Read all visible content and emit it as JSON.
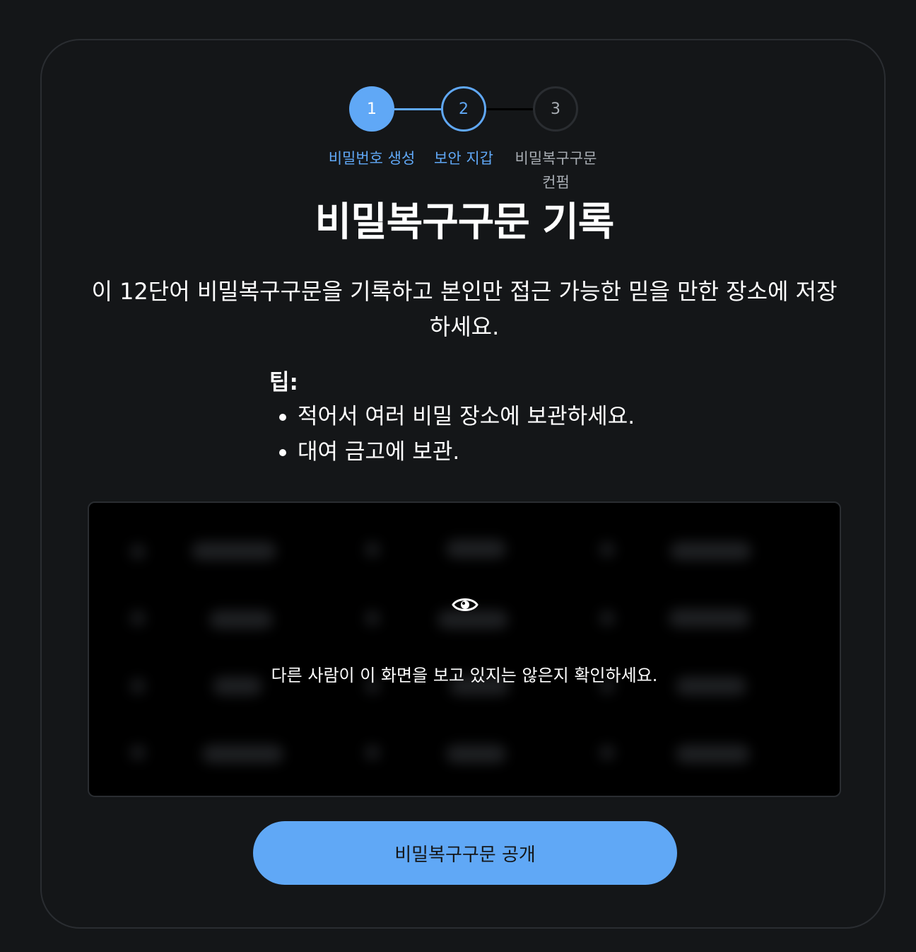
{
  "stepper": {
    "steps": [
      {
        "number": "1",
        "label": "비밀번호 생성",
        "state": "completed"
      },
      {
        "number": "2",
        "label": "보안 지갑",
        "state": "active"
      },
      {
        "number": "3",
        "label": "비밀복구구문 컨펌",
        "state": "pending"
      }
    ]
  },
  "page": {
    "title": "비밀복구구문 기록",
    "description": "이 12단어 비밀복구구문을 기록하고 본인만 접근 가능한 믿을 만한 장소에 저장하세요."
  },
  "tips": {
    "heading": "팁:",
    "items": [
      "적어서 여러 비밀 장소에 보관하세요.",
      "대여 금고에 보관."
    ]
  },
  "seed_box": {
    "icon": "eye-icon",
    "warning": "다른 사람이 이 화면을 보고 있지는 않은지 확인하세요."
  },
  "actions": {
    "reveal_label": "비밀복구구문 공개"
  },
  "colors": {
    "background": "#141618",
    "accent": "#60a8f6",
    "muted": "#a8adb3",
    "border": "#2a2d31"
  }
}
